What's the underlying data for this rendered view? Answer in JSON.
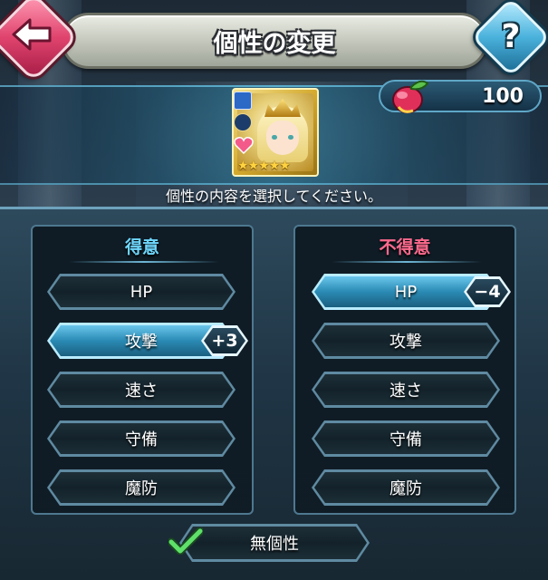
{
  "header": {
    "title": "個性の変更",
    "back_icon": "back-arrow-icon",
    "help_label": "?"
  },
  "currency": {
    "icon": "divine-fruit-icon",
    "value": "100"
  },
  "hero": {
    "stars": "★★★★★",
    "rarity": 5,
    "weapon_icon": "sword-icon",
    "move_icon": "infantry-icon",
    "heart_icon": "heart-icon"
  },
  "instruction": "個性の内容を選択してください。",
  "boon": {
    "title": "得意",
    "selected_stat": "攻撃",
    "badge": "+3",
    "stats": [
      "HP",
      "攻撃",
      "速さ",
      "守備",
      "魔防"
    ]
  },
  "bane": {
    "title": "不得意",
    "selected_stat": "HP",
    "badge": "−4",
    "stats": [
      "HP",
      "攻撃",
      "速さ",
      "守備",
      "魔防"
    ]
  },
  "neutral": {
    "label": "無個性",
    "checked": true
  },
  "colors": {
    "boon_title": "#6fd8ff",
    "bane_title": "#ff6a8e",
    "selected_button": "#2a8ab3",
    "check": "#5fe06a"
  }
}
